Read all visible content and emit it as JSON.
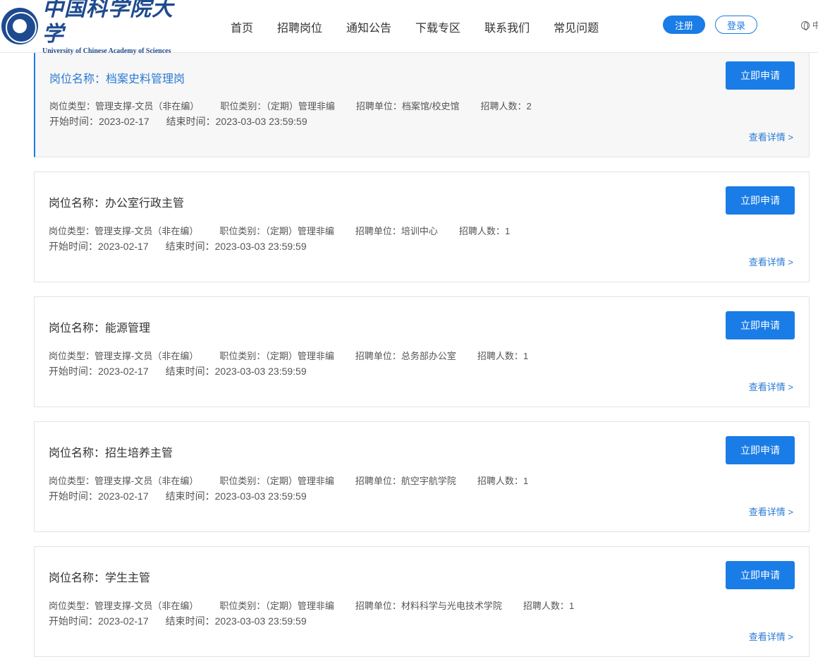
{
  "header": {
    "logo_cn": "中国科学院大学",
    "logo_en": "University of Chinese Academy of Sciences",
    "nav": [
      "首页",
      "招聘岗位",
      "通知公告",
      "下载专区",
      "联系我们",
      "常见问题"
    ],
    "register_label": "注册",
    "login_label": "登录",
    "lang_label": "中"
  },
  "labels": {
    "title_prefix": "岗位名称：",
    "type_prefix": "岗位类型：",
    "category_prefix": "职位类别：",
    "unit_prefix": "招聘单位：",
    "count_prefix": "招聘人数：",
    "start_prefix": "开始时间：",
    "end_prefix": "结束时间：",
    "apply": "立即申请",
    "detail": "查看详情 >"
  },
  "colors": {
    "accent": "#1a7ce6",
    "link": "#2a7ad4",
    "brand": "#1e4a8f"
  },
  "jobs": [
    {
      "title": "档案史料管理岗",
      "type": "管理支撑-文员（非在编）",
      "category": "（定期）管理非编",
      "unit": "档案馆/校史馆",
      "count": "2",
      "start": "2023-02-17",
      "end": "2023-03-03 23:59:59"
    },
    {
      "title": "办公室行政主管",
      "type": "管理支撑-文员（非在编）",
      "category": "（定期）管理非编",
      "unit": "培训中心",
      "count": "1",
      "start": "2023-02-17",
      "end": "2023-03-03 23:59:59"
    },
    {
      "title": "能源管理",
      "type": "管理支撑-文员（非在编）",
      "category": "（定期）管理非编",
      "unit": "总务部办公室",
      "count": "1",
      "start": "2023-02-17",
      "end": "2023-03-03 23:59:59"
    },
    {
      "title": "招生培养主管",
      "type": "管理支撑-文员（非在编）",
      "category": "（定期）管理非编",
      "unit": "航空宇航学院",
      "count": "1",
      "start": "2023-02-17",
      "end": "2023-03-03 23:59:59"
    },
    {
      "title": "学生主管",
      "type": "管理支撑-文员（非在编）",
      "category": "（定期）管理非编",
      "unit": "材料科学与光电技术学院",
      "count": "1",
      "start": "2023-02-17",
      "end": "2023-03-03 23:59:59"
    }
  ]
}
